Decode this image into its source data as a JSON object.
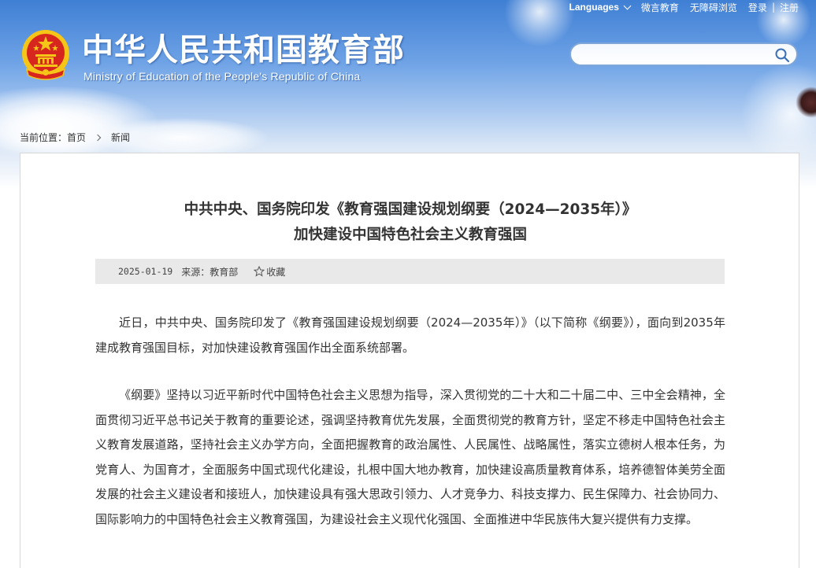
{
  "header": {
    "title_cn": "中华人民共和国教育部",
    "title_en": "Ministry of Education of the People's Republic of China",
    "emblem_icon": "national-emblem-icon"
  },
  "topbar": {
    "languages_label": "Languages",
    "weibo_label": "微言教育",
    "accessibility_label": "无障碍浏览",
    "login_label": "登录",
    "separator": "|",
    "register_label": "注册"
  },
  "search": {
    "placeholder": "",
    "icon": "search-icon"
  },
  "breadcrumb": {
    "prefix": "当前位置：",
    "home": "首页",
    "current": "新闻"
  },
  "article": {
    "title_line1": "中共中央、国务院印发《教育强国建设规划纲要（2024—2035年）》",
    "title_line2": "加快建设中国特色社会主义教育强国",
    "date": "2025-01-19",
    "source": "来源：教育部",
    "favorite_label": "收藏",
    "paragraphs": [
      "近日，中共中央、国务院印发了《教育强国建设规划纲要（2024—2035年）》（以下简称《纲要》），面向到2035年建成教育强国目标，对加快建设教育强国作出全面系统部署。",
      "《纲要》坚持以习近平新时代中国特色社会主义思想为指导，深入贯彻党的二十大和二十届二中、三中全会精神，全面贯彻习近平总书记关于教育的重要论述，强调坚持教育优先发展，全面贯彻党的教育方针，坚定不移走中国特色社会主义教育发展道路，坚持社会主义办学方向，全面把握教育的政治属性、人民属性、战略属性，落实立德树人根本任务，为党育人、为国育才，全面服务中国式现代化建设，扎根中国大地办教育，加快建设高质量教育体系，培养德智体美劳全面发展的社会主义建设者和接班人，加快建设具有强大思政引领力、人才竞争力、科技支撑力、民生保障力、社会协同力、国际影响力的中国特色社会主义教育强国，为建设社会主义现代化强国、全面推进中华民族伟大复兴提供有力支撑。"
    ]
  },
  "colors": {
    "header_blue": "#3f7fd4",
    "text": "#333333",
    "meta_bg": "#e9e9e9",
    "emblem_red": "#d7261e",
    "emblem_gold": "#f5c518"
  }
}
